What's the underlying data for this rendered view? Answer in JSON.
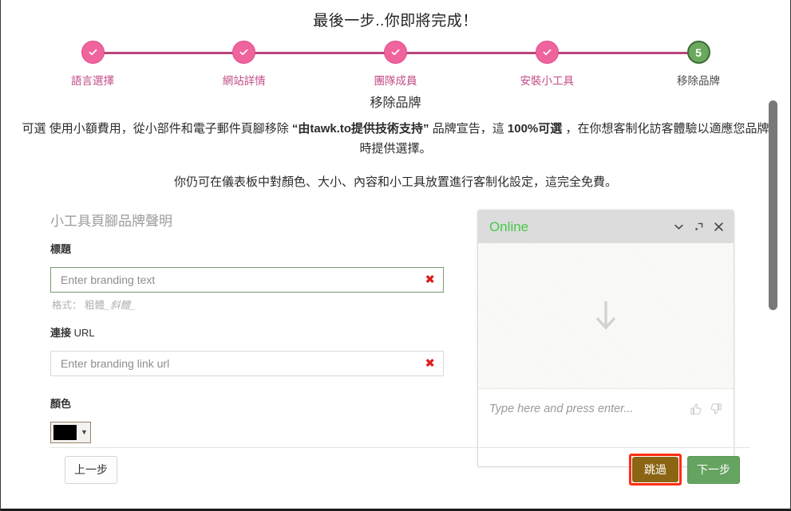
{
  "wizard": {
    "title": "最後一步..你即將完成！",
    "steps": [
      {
        "label": "語言選擇",
        "state": "done",
        "marker": "check"
      },
      {
        "label": "網站詳情",
        "state": "done",
        "marker": "check"
      },
      {
        "label": "團隊成員",
        "state": "done",
        "marker": "check"
      },
      {
        "label": "安裝小工具",
        "state": "done",
        "marker": "check"
      },
      {
        "label": "移除品牌",
        "state": "current",
        "marker": "5"
      }
    ],
    "colors": {
      "done": "#f0649e",
      "line": "#b9447b",
      "current": "#6aa95d",
      "label": "#c24c86"
    }
  },
  "section": {
    "title": "移除品牌",
    "paragraph1_a": "可選 使用小額費用，從小部件和電子郵件頁腳移除 ",
    "paragraph1_b": "“由tawk.to提供技術支持”",
    "paragraph1_c": " 品牌宣告，這 ",
    "paragraph1_d": "100%可選",
    "paragraph1_e": " ，在你想客制化訪客體驗以適應您品牌時提供選擇。",
    "paragraph2": "你仍可在儀表板中對顏色、大小、內容和小工具放置進行客制化設定，這完全免費。"
  },
  "form": {
    "subhead": "小工具頁腳品牌聲明",
    "title_label": "標題",
    "title_value": "",
    "title_placeholder": "Enter branding text",
    "format_hint_prefix": "格式：",
    "format_hint_bold": "粗體",
    "format_hint_italic": "_斜體_",
    "url_label_strong": "連接",
    "url_label_light": " URL",
    "url_value": "",
    "url_placeholder": "Enter branding link url",
    "color_label": "顏色",
    "color_value": "#000000",
    "clear_icon": "✖"
  },
  "widget": {
    "status": "Online",
    "status_color": "#44c94a",
    "input_placeholder": "Type here and press enter...",
    "icons": {
      "minimize": "chevron-down-icon",
      "expand": "expand-icon",
      "close": "close-icon",
      "thumbs_up": "thumbs-up-icon",
      "thumbs_down": "thumbs-down-icon",
      "arrow": "arrow-down-icon"
    }
  },
  "footer": {
    "back_label": "上一步",
    "skip_label": "跳過",
    "next_label": "下一步",
    "skip_highlight_color": "#ff2d10",
    "skip_bg": "#8c6514",
    "next_bg": "#65a361"
  }
}
